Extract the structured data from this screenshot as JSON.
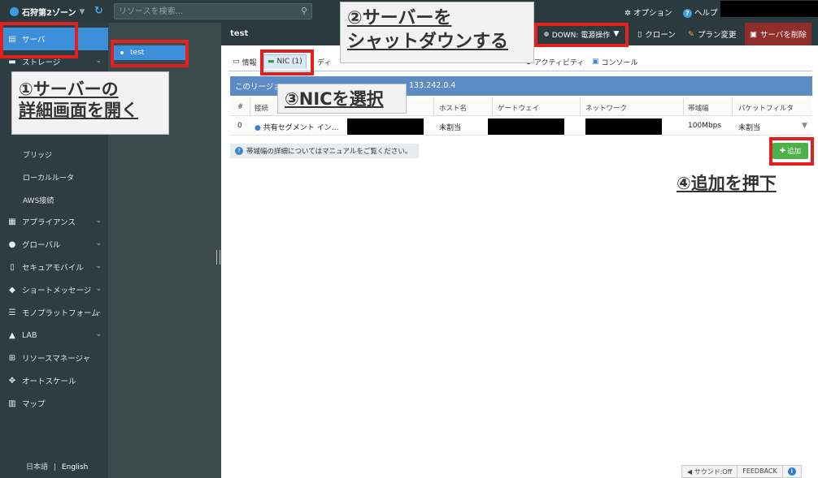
{
  "topbar": {
    "zone": "石狩第2ゾーン",
    "search_placeholder": "リソースを検索...",
    "options": "オプション",
    "help": "ヘルプ"
  },
  "sidebar": {
    "items": [
      {
        "label": "サーバ",
        "icon": "server-icon"
      },
      {
        "label": "ストレージ",
        "icon": "storage-icon"
      }
    ],
    "subitems": [
      "ブリッジ",
      "ローカルルータ",
      "AWS接続"
    ],
    "groups": [
      {
        "label": "アプライアンス",
        "icon": "grid-icon"
      },
      {
        "label": "グローバル",
        "icon": "globe-icon"
      },
      {
        "label": "セキュアモバイル",
        "icon": "mobile-icon"
      },
      {
        "label": "ショートメッセージ",
        "icon": "chat-icon"
      },
      {
        "label": "モノプラットフォーム",
        "icon": "list-icon"
      },
      {
        "label": "LAB",
        "icon": "flask-icon"
      },
      {
        "label": "リソースマネージャ",
        "icon": "org-icon"
      },
      {
        "label": "オートスケール",
        "icon": "move-icon"
      },
      {
        "label": "マップ",
        "icon": "map-icon"
      }
    ],
    "lang_ja": "日本語",
    "lang_sep": "|",
    "lang_en": "English"
  },
  "resource_list": {
    "selected": "test"
  },
  "header": {
    "title": "test",
    "status": "DOWN: 電源操作",
    "clone": "クローン",
    "plan_change": "プラン変更",
    "delete": "サーバを削除"
  },
  "tabs": [
    "情報",
    "NIC (1)",
    "ディ",
    "アクティビティ",
    "コンソール"
  ],
  "region_bar": {
    "prefix": "このリージョ",
    "ip": "133.242.0.4"
  },
  "table": {
    "headers": [
      "#",
      "接続",
      "ホスト名",
      "ゲートウェイ",
      "ネットワーク",
      "帯域幅",
      "パケットフィルタ"
    ],
    "row": {
      "index": "0",
      "connection": "共有セグメント イン…",
      "hostname": "未割当",
      "bandwidth": "100Mbps",
      "packet_filter": "未割当"
    }
  },
  "info_text": "帯域幅の詳細についてはマニュアルをご覧ください。",
  "add_button": "追加",
  "footer": {
    "sound": "サウンド:Off",
    "feedback": "FEEDBACK"
  },
  "callouts": {
    "step1_line1": "①サーバーの",
    "step1_line2": "詳細画面を開く",
    "step2_line1": "②サーバーを",
    "step2_line2": "シャットダウンする",
    "step3": "③NICを選択",
    "step4": "④追加を押下"
  },
  "colors": {
    "highlight": "#e2211f",
    "selected": "#3d8ed8",
    "add": "#4db04a",
    "region_bar": "#5d8bc4"
  }
}
